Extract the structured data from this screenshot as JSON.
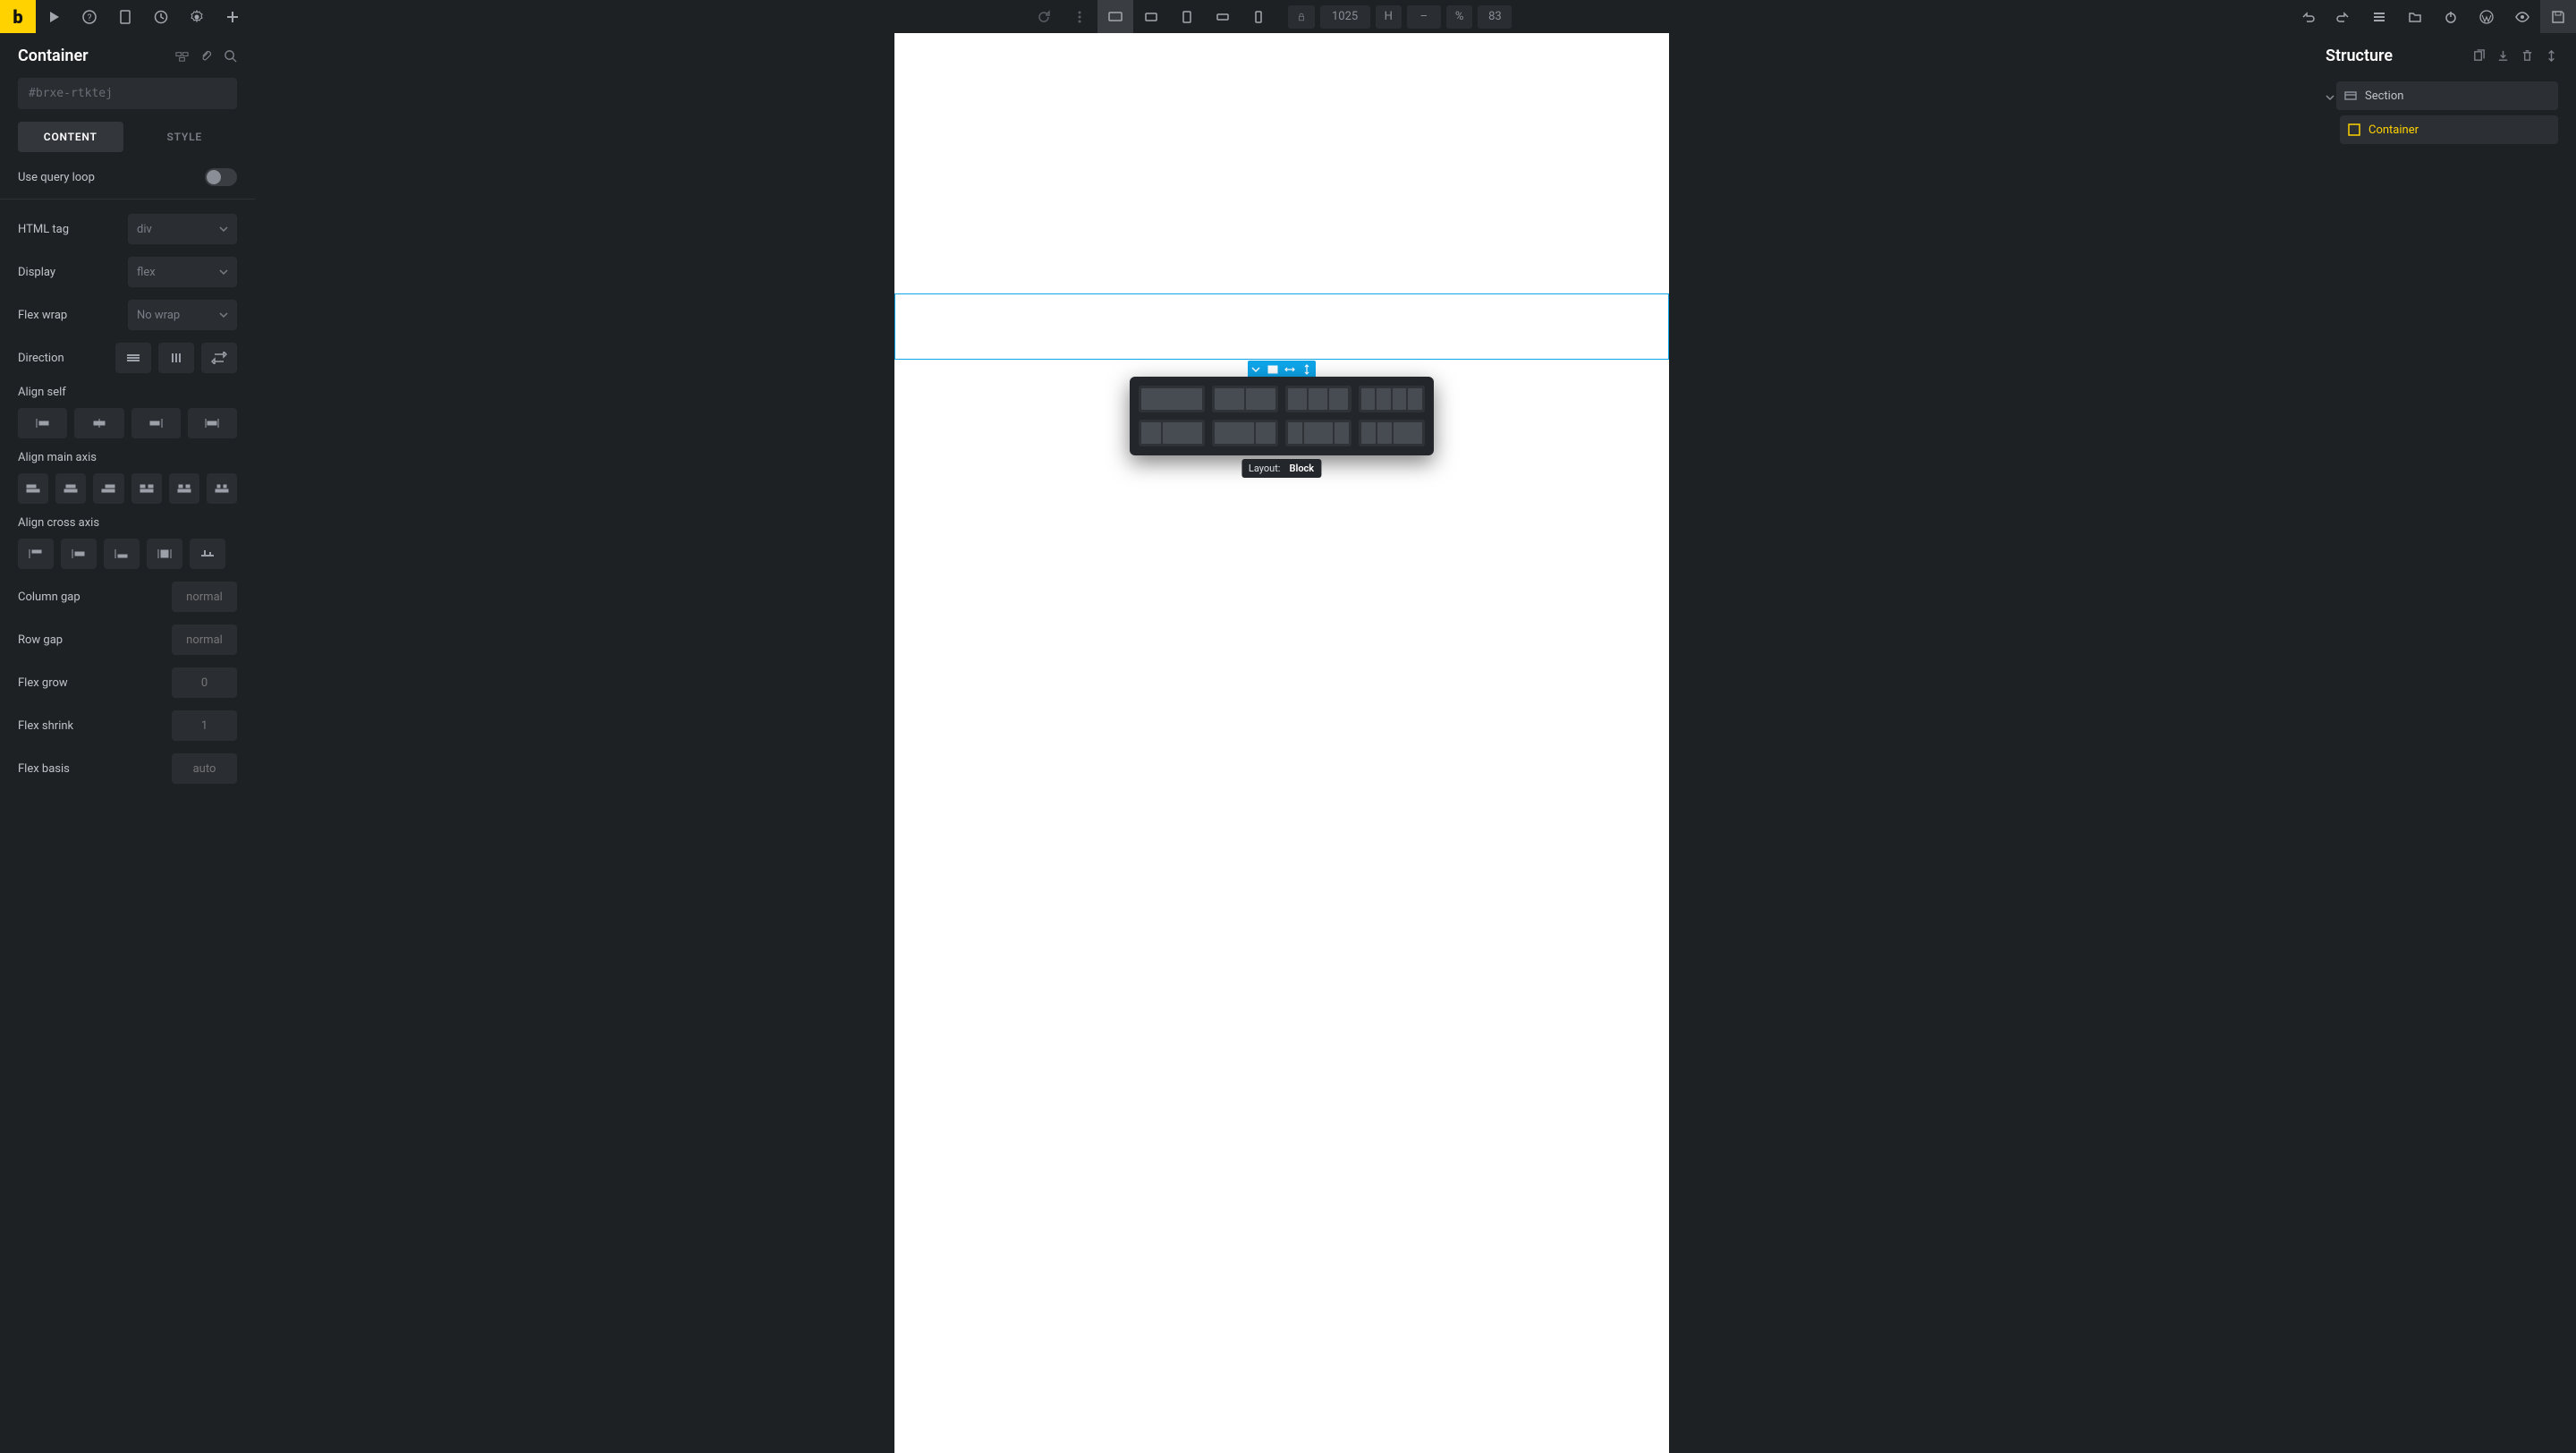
{
  "logo": "b",
  "dimensions": {
    "width": "1025",
    "height_label": "H",
    "height_val": "–",
    "pct_label": "%",
    "pct_val": "83"
  },
  "left": {
    "title": "Container",
    "id": "#brxe-rtktej",
    "tabs": {
      "content": "CONTENT",
      "style": "STYLE"
    },
    "query_loop": "Use query loop",
    "html_tag": {
      "label": "HTML tag",
      "value": "div"
    },
    "display": {
      "label": "Display",
      "value": "flex"
    },
    "flex_wrap": {
      "label": "Flex wrap",
      "value": "No wrap"
    },
    "direction": "Direction",
    "align_self": "Align self",
    "align_main": "Align main axis",
    "align_cross": "Align cross axis",
    "col_gap": {
      "label": "Column gap",
      "placeholder": "normal"
    },
    "row_gap": {
      "label": "Row gap",
      "placeholder": "normal"
    },
    "grow": {
      "label": "Flex grow",
      "placeholder": "0"
    },
    "shrink": {
      "label": "Flex shrink",
      "placeholder": "1"
    },
    "basis": {
      "label": "Flex basis",
      "placeholder": "auto"
    }
  },
  "tooltip": {
    "label": "Layout:",
    "value": "Block"
  },
  "right": {
    "title": "Structure",
    "section": "Section",
    "container": "Container"
  }
}
